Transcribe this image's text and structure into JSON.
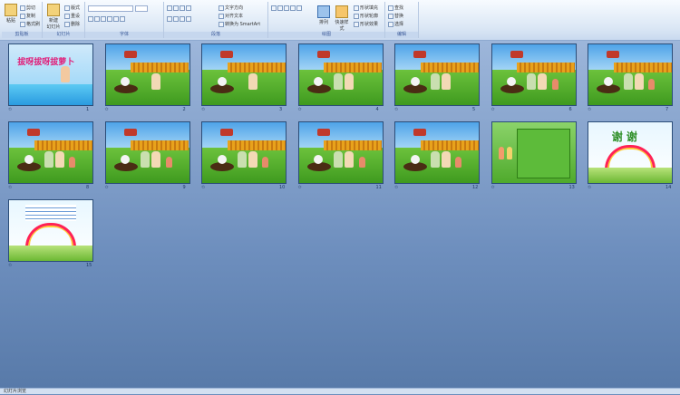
{
  "ribbon": {
    "clipboard": {
      "paste": "粘贴",
      "cut": "剪切",
      "copy": "复制",
      "format_painter": "格式刷",
      "label": "剪贴板"
    },
    "slides": {
      "new_slide": "新建",
      "new_slide_sub": "幻灯片",
      "layout": "版式",
      "reset": "重设",
      "delete": "删除",
      "label": "幻灯片"
    },
    "font": {
      "label": "字体"
    },
    "paragraph": {
      "text_direction": "文字方向",
      "align_text": "对齐文本",
      "smartart": "转换为 SmartArt",
      "label": "段落"
    },
    "drawing": {
      "arrange": "排列",
      "quick_styles": "快速样式",
      "shape_fill": "形状填充",
      "shape_outline": "形状轮廓",
      "shape_effects": "形状效果",
      "label": "绘图"
    },
    "editing": {
      "find": "查找",
      "replace": "替换",
      "select": "选择",
      "label": "编辑"
    }
  },
  "slides": [
    {
      "n": "1",
      "kind": "title",
      "title": "拔呀拔呀拔萝卜"
    },
    {
      "n": "2",
      "kind": "farm"
    },
    {
      "n": "3",
      "kind": "farm"
    },
    {
      "n": "4",
      "kind": "farm"
    },
    {
      "n": "5",
      "kind": "farm"
    },
    {
      "n": "6",
      "kind": "farm"
    },
    {
      "n": "7",
      "kind": "farm"
    },
    {
      "n": "8",
      "kind": "farm"
    },
    {
      "n": "9",
      "kind": "farm"
    },
    {
      "n": "10",
      "kind": "farm"
    },
    {
      "n": "11",
      "kind": "farm"
    },
    {
      "n": "12",
      "kind": "farm"
    },
    {
      "n": "13",
      "kind": "green"
    },
    {
      "n": "14",
      "kind": "thanks",
      "title": "谢 谢"
    },
    {
      "n": "15",
      "kind": "thanks"
    }
  ],
  "status": {
    "text": "幻灯片浏览"
  }
}
